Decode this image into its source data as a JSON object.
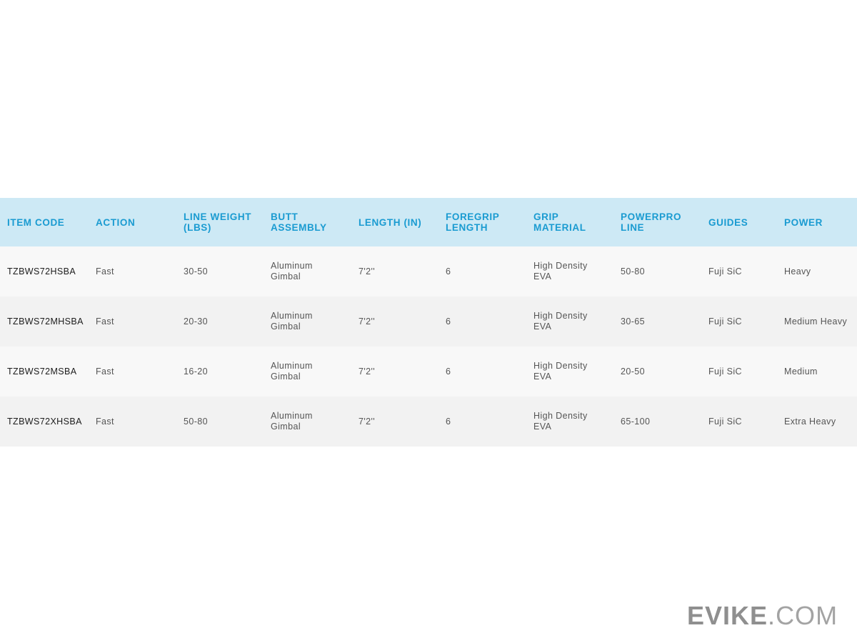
{
  "table": {
    "headers": [
      "ITEM CODE",
      "ACTION",
      "LINE WEIGHT\n(LBS)",
      "BUTT\nASSEMBLY",
      "LENGTH (IN)",
      "FOREGRIP\nLENGTH",
      "GRIP\nMATERIAL",
      "POWERPRO\nLINE",
      "GUIDES",
      "POWER"
    ],
    "rows": [
      [
        "TZBWS72HSBA",
        "Fast",
        "30-50",
        "Aluminum\nGimbal",
        "7'2''",
        "6",
        "High Density\nEVA",
        "50-80",
        "Fuji SiC",
        "Heavy"
      ],
      [
        "TZBWS72MHSBA",
        "Fast",
        "20-30",
        "Aluminum\nGimbal",
        "7'2''",
        "6",
        "High Density\nEVA",
        "30-65",
        "Fuji SiC",
        "Medium Heavy"
      ],
      [
        "TZBWS72MSBA",
        "Fast",
        "16-20",
        "Aluminum\nGimbal",
        "7'2''",
        "6",
        "High Density\nEVA",
        "20-50",
        "Fuji SiC",
        "Medium"
      ],
      [
        "TZBWS72XHSBA",
        "Fast",
        "50-80",
        "Aluminum\nGimbal",
        "7'2''",
        "6",
        "High Density\nEVA",
        "65-100",
        "Fuji SiC",
        "Extra Heavy"
      ]
    ]
  },
  "watermark": {
    "brand": "EVIKE",
    "dot": ".",
    "tld": "COM"
  },
  "colors": {
    "header_bg": "#cde9f5",
    "header_text": "#1a9bd1",
    "row_odd": "#f8f8f8",
    "row_even": "#f2f2f2"
  }
}
